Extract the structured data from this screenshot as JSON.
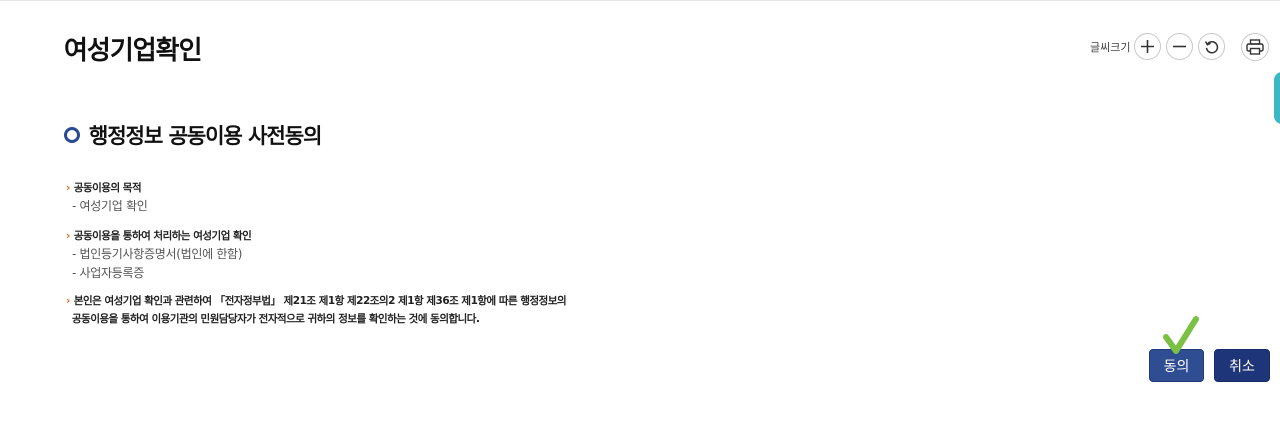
{
  "page": {
    "title": "여성기업확인"
  },
  "font_tools": {
    "label": "글씨크기",
    "increase_icon": "plus-icon",
    "decrease_icon": "minus-icon",
    "reset_icon": "refresh-icon",
    "print_icon": "printer-icon"
  },
  "section": {
    "title": "행정정보 공동이용 사전동의"
  },
  "purpose": {
    "heading": "공동이용의 목적",
    "items": [
      "- 여성기업 확인"
    ]
  },
  "documents": {
    "heading": "공동이용을 통하여 처리하는 여성기업 확인",
    "items": [
      "- 법인등기사항증명서(법인에 한함)",
      "- 사업자등록증"
    ]
  },
  "consent": {
    "line1": "본인은 여성기업 확인과 관련하여 「전자정부법」 제21조 제1항 제22조의2 제1항 제36조 제1항에 따른 행정정보의",
    "line2": "공동이용을 통하여 이용기관의 민원담당자가 전자적으로 귀하의 정보를 확인하는 것에 동의합니다."
  },
  "actions": {
    "agree_label": "동의",
    "cancel_label": "취소"
  },
  "colors": {
    "primary": "#2f4d92",
    "accent_arrow": "#e46a1c",
    "check_mark": "#7ac143",
    "side_tab": "#3bb7c5"
  }
}
